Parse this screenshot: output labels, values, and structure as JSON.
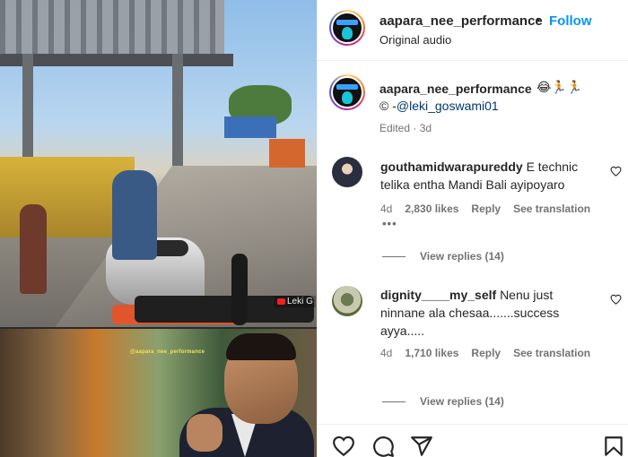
{
  "post": {
    "media": {
      "watermark": "Leki G",
      "meme_caption": "@aapara_nee_performance"
    }
  },
  "header": {
    "username": "aapara_nee_performance",
    "separator": "•",
    "follow_label": "Follow",
    "audio": "Original audio",
    "avatar_icon": "profile-avatar-icon"
  },
  "caption": {
    "username": "aapara_nee_performance",
    "emoji": "😂🏃🏃",
    "credit_prefix": "© -",
    "mention": "@leki_goswami01",
    "meta": "Edited · 3d"
  },
  "comments": [
    {
      "username": "gouthamidwarapureddy",
      "text": "E technic telika entha Mandi Bali ayipoyaro",
      "age": "4d",
      "likes": "2,830 likes",
      "reply_label": "Reply",
      "translate_label": "See translation",
      "more": "•••",
      "view_replies": "View replies (14)"
    },
    {
      "username": "dignity____my_self",
      "text": "Nenu just ninnane ala chesaa.......success ayya.....",
      "age": "4d",
      "likes": "1,710 likes",
      "reply_label": "Reply",
      "translate_label": "See translation",
      "view_replies": "View replies (14)"
    }
  ],
  "actions": {
    "icons": [
      "heart-icon",
      "comment-icon",
      "share-icon",
      "bookmark-icon"
    ]
  }
}
